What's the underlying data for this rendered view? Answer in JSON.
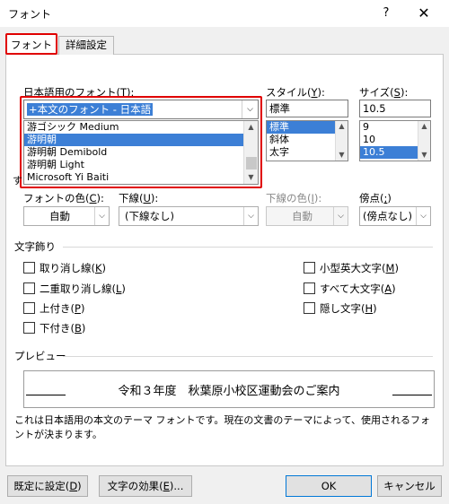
{
  "window": {
    "title": "フォント",
    "help": "?",
    "close": "✕"
  },
  "tabs": [
    {
      "label": "フォント"
    },
    {
      "label": "詳細設定"
    }
  ],
  "japanese_font": {
    "label_prefix": "日本語用のフォント(",
    "label_key": "T",
    "label_suffix": "):",
    "value": "+本文のフォント - 日本語",
    "list": [
      "游ゴシック Medium",
      "游明朝",
      "游明朝 Demibold",
      "游明朝 Light",
      "Microsoft Yi Baiti"
    ],
    "selected_index": 1,
    "partial_label": "す"
  },
  "style": {
    "label_prefix": "スタイル(",
    "label_key": "Y",
    "label_suffix": "):",
    "value": "標準",
    "list": [
      "標準",
      "斜体",
      "太字"
    ],
    "selected_index": 0
  },
  "size": {
    "label_prefix": "サイズ(",
    "label_key": "S",
    "label_suffix": "):",
    "value": "10.5",
    "list": [
      "9",
      "10",
      "10.5"
    ],
    "selected_index": 2
  },
  "font_color": {
    "label_prefix": "フォントの色(",
    "label_key": "C",
    "label_suffix": "):",
    "value": "自動"
  },
  "underline": {
    "label_prefix": "下線(",
    "label_key": "U",
    "label_suffix": "):",
    "value": "(下線なし)"
  },
  "underline_color": {
    "label_prefix": "下線の色(",
    "label_key": "I",
    "label_suffix": "):",
    "value": "自動"
  },
  "emphasis": {
    "label_prefix": "傍点(",
    "label_key": ";",
    "label_suffix": ")",
    "value": "(傍点なし)"
  },
  "effects": {
    "header": "文字飾り",
    "left": [
      {
        "prefix": "取り消し線(",
        "key": "K",
        "suffix": ")"
      },
      {
        "prefix": "二重取り消し線(",
        "key": "L",
        "suffix": ")"
      },
      {
        "prefix": "上付き(",
        "key": "P",
        "suffix": ")"
      },
      {
        "prefix": "下付き(",
        "key": "B",
        "suffix": ")"
      }
    ],
    "right": [
      {
        "prefix": "小型英大文字(",
        "key": "M",
        "suffix": ")"
      },
      {
        "prefix": "すべて大文字(",
        "key": "A",
        "suffix": ")"
      },
      {
        "prefix": "隠し文字(",
        "key": "H",
        "suffix": ")"
      }
    ]
  },
  "preview": {
    "header": "プレビュー",
    "text": "令和３年度　秋葉原小校区運動会のご案内",
    "description": "これは日本語用の本文のテーマ フォントです。現在の文書のテーマによって、使用されるフォントが決まります。"
  },
  "buttons": {
    "default": {
      "prefix": "既定に設定(",
      "key": "D",
      "suffix": ")"
    },
    "effects": {
      "prefix": "文字の効果(",
      "key": "E",
      "suffix": ")..."
    },
    "ok": "OK",
    "cancel": "キャンセル"
  },
  "colors": {
    "highlight": "#3c7fd6",
    "annotation_red": "#e00000",
    "ok_border": "#0078d7"
  }
}
